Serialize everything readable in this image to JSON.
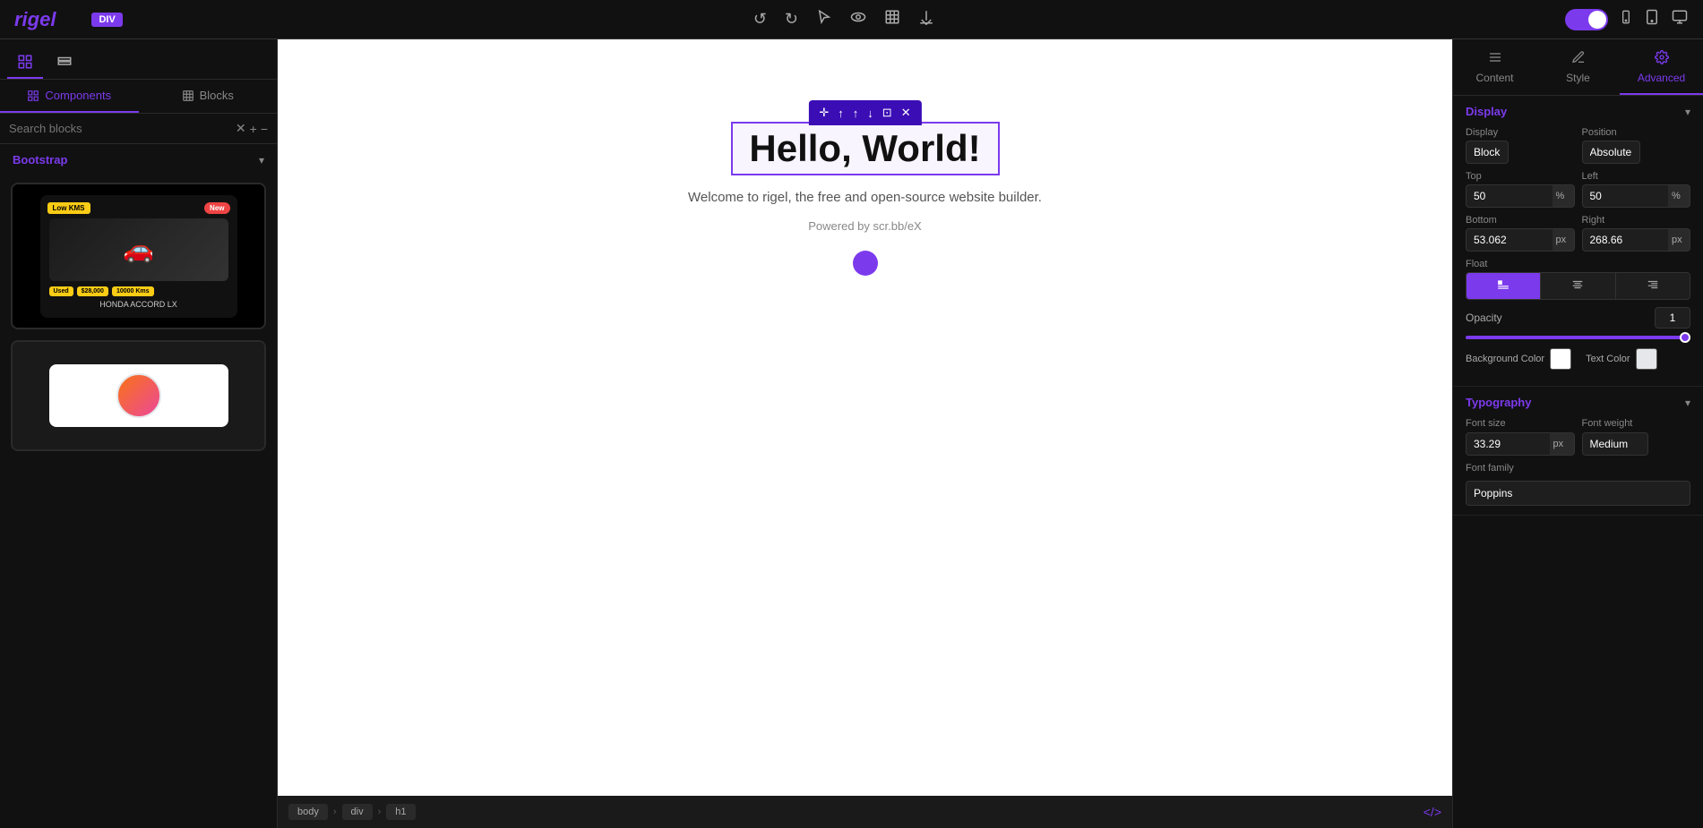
{
  "app": {
    "logo": "rigel",
    "div_badge": "DIV"
  },
  "toolbar": {
    "undo": "↺",
    "redo": "↻",
    "cursor": "↖",
    "eye": "👁",
    "frame": "⊡",
    "download": "⬇"
  },
  "left_panel": {
    "search_placeholder": "Search blocks",
    "section_label": "Bootstrap",
    "components_tab": "Components",
    "blocks_tab": "Blocks",
    "car_card": {
      "badge_low": "Low KMS",
      "badge_new": "New",
      "tag_used": "Used",
      "tag_price": "$28,000",
      "tag_km": "10000 Kms",
      "name": "HONDA ACCORD LX"
    }
  },
  "canvas": {
    "breadcrumb": [
      "body",
      "div",
      "h1"
    ],
    "h1_text": "Hello, World!",
    "subtitle": "Welcome to rigel, the free and open-source website builder.",
    "powered": "Powered by scr.bb/eX"
  },
  "right_panel": {
    "tabs": [
      {
        "id": "content",
        "label": "Content",
        "icon": "≡"
      },
      {
        "id": "style",
        "label": "Style",
        "icon": "✏"
      },
      {
        "id": "advanced",
        "label": "Advanced",
        "icon": "⚙"
      }
    ],
    "active_tab": "advanced",
    "display_section": {
      "title": "Display",
      "display_label": "Display",
      "display_value": "Block",
      "position_label": "Position",
      "position_value": "Absolute",
      "top_label": "Top",
      "top_value": "50",
      "top_unit": "%",
      "left_label": "Left",
      "left_value": "50",
      "left_unit": "%",
      "bottom_label": "Bottom",
      "bottom_value": "53.062",
      "bottom_unit": "px",
      "right_label": "Right",
      "right_value": "268.66",
      "right_unit": "px",
      "float_label": "Float",
      "float_options": [
        "left",
        "center",
        "right"
      ],
      "float_active": "left",
      "opacity_label": "Opacity",
      "opacity_value": "1",
      "bg_color_label": "Background Color",
      "text_color_label": "Text Color"
    },
    "typography_section": {
      "title": "Typography",
      "font_size_label": "Font size",
      "font_size_value": "33.29",
      "font_size_unit": "px",
      "font_weight_label": "Font weight",
      "font_weight_value": "Medium",
      "font_family_label": "Font family",
      "font_family_value": "Poppins"
    }
  }
}
